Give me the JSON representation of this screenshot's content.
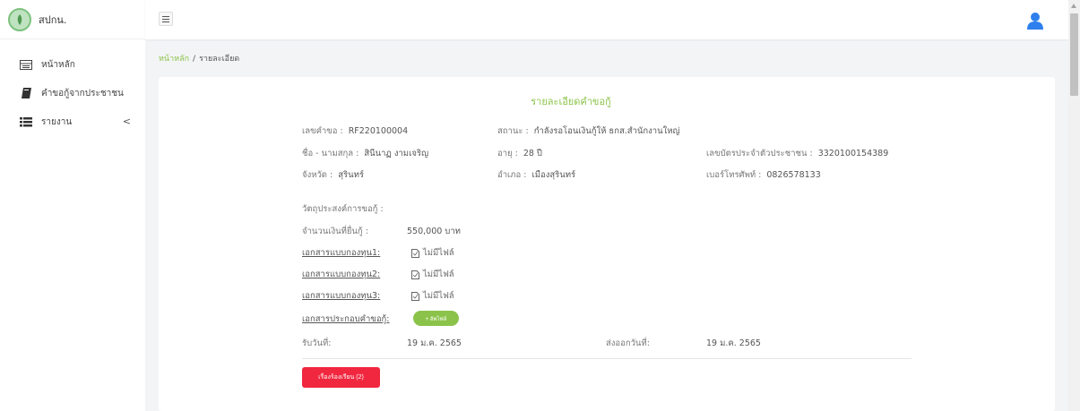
{
  "brand": {
    "name": "สปกน."
  },
  "sidebar": {
    "items": [
      {
        "label": "หน้าหลัก",
        "icon": "table-icon"
      },
      {
        "label": "คำขอกู้จากประชาชน",
        "icon": "book-icon"
      },
      {
        "label": "รายงาน",
        "icon": "list-icon",
        "chevron": "<"
      }
    ]
  },
  "breadcrumb": {
    "home": "หน้าหลัก",
    "separator": "/",
    "current": "รายละเอียด"
  },
  "card": {
    "title": "รายละเอียดคำขอกู้",
    "request_no": {
      "label": "เลขคำขอ :",
      "value": "RF220100004"
    },
    "status": {
      "label": "สถานะ :",
      "value": "กำลังรอโอนเงินกู้ให้ ธกส.สำนักงานใหญ่"
    },
    "fullname": {
      "label": "ชื่อ - นามสกุล :",
      "value": "สินีนาฏ งามเจริญ"
    },
    "age": {
      "label": "อายุ :",
      "value": "28 ปี"
    },
    "id_card": {
      "label": "เลขบัตรประจำตัวประชาชน :",
      "value": "3320100154389"
    },
    "province": {
      "label": "จังหวัด :",
      "value": "สุรินทร์"
    },
    "district": {
      "label": "อำเภอ :",
      "value": "เมืองสุรินทร์"
    },
    "phone": {
      "label": "เบอร์โทรศัพท์ :",
      "value": "0826578133"
    },
    "purpose": {
      "label": "วัตถุประสงค์การขอกู้ :"
    },
    "amount": {
      "label": "จำนวนเงินที่ยื่นกู้ :",
      "value": "550,000 บาท"
    },
    "docs": [
      {
        "label": "เอกสารแบบกองทุน1:",
        "status": "ไม่มีไฟล์"
      },
      {
        "label": "เอกสารแบบกองทุน2:",
        "status": "ไม่มีไฟล์"
      },
      {
        "label": "เอกสารแบบกองทุน3:",
        "status": "ไม่มีไฟล์"
      }
    ],
    "attachments": {
      "label": "เอกสารประกอบคำขอกู้:",
      "upload_label": "+ อัพไฟล์"
    },
    "received": {
      "label": "รับวันที่:",
      "value": "19 ม.ค. 2565"
    },
    "sent": {
      "label": "ส่งออกวันที่:",
      "value": "19 ม.ค. 2565"
    },
    "complaint_button": "เรื่องร้องเรียน (2)"
  },
  "colors": {
    "accent": "#8bc34a",
    "danger": "#f0273f",
    "user_icon": "#2f80ed"
  }
}
